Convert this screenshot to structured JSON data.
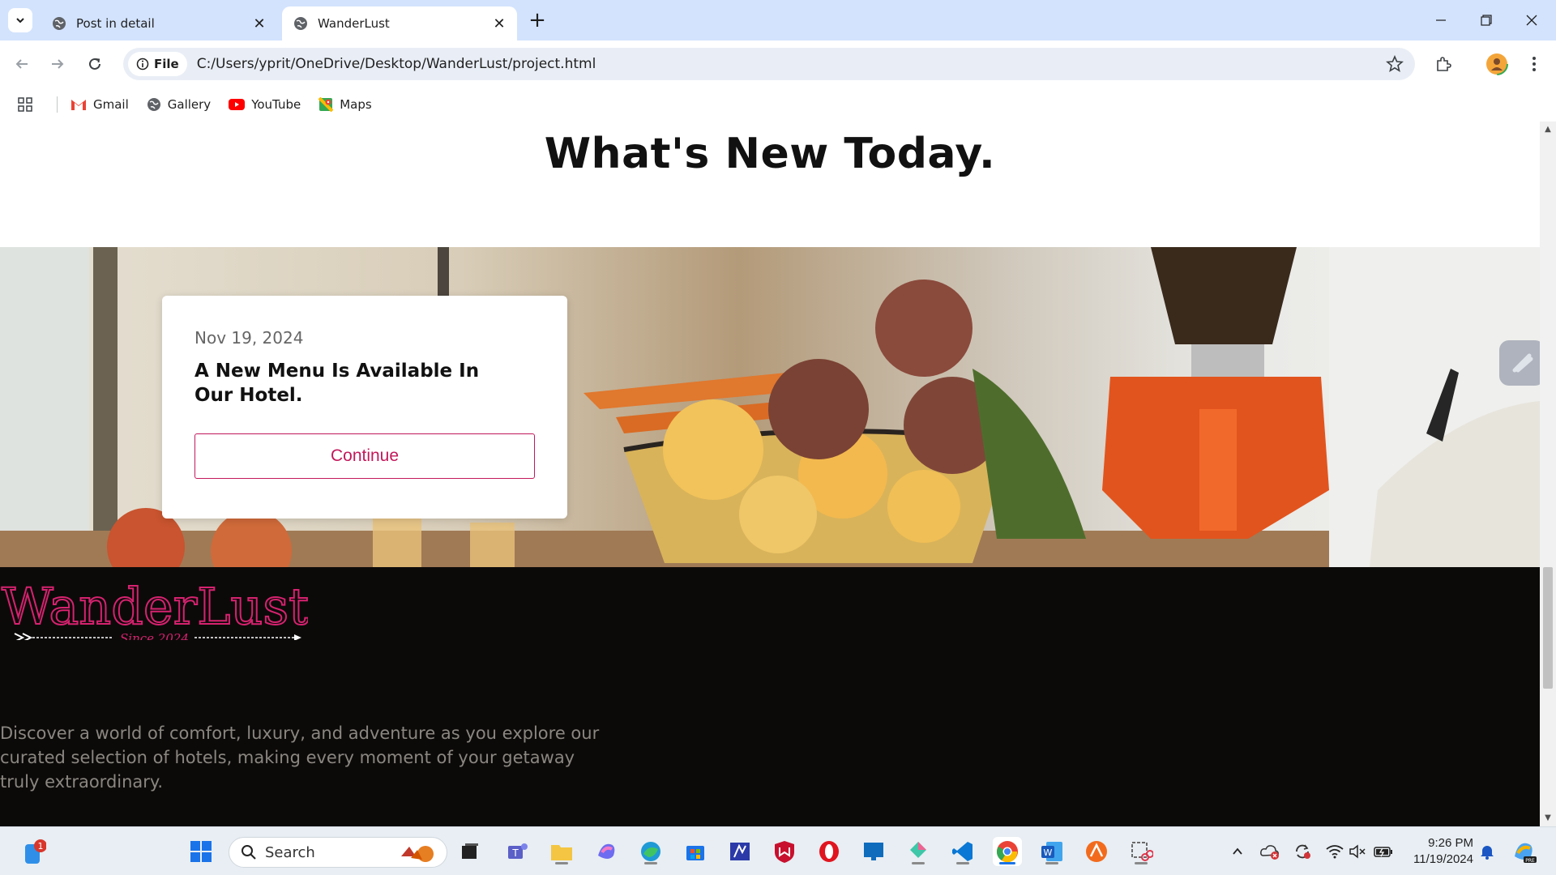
{
  "browser": {
    "tabs": [
      {
        "title": "Post in detail",
        "active": false
      },
      {
        "title": "WanderLust",
        "active": true
      }
    ],
    "file_chip": "File",
    "url": "C:/Users/yprit/OneDrive/Desktop/WanderLust/project.html",
    "bookmarks": [
      {
        "label": "Gmail",
        "icon": "gmail-icon"
      },
      {
        "label": "Gallery",
        "icon": "globe-icon"
      },
      {
        "label": "YouTube",
        "icon": "youtube-icon"
      },
      {
        "label": "Maps",
        "icon": "maps-icon"
      }
    ]
  },
  "page": {
    "heading": "What's New Today.",
    "card": {
      "date": "Nov 19, 2024",
      "title": "A New Menu Is Available In Our Hotel.",
      "button": "Continue"
    },
    "footer": {
      "logo_text": "WanderLust",
      "logo_tagline": "Since 2024",
      "description": "Discover a world of comfort, luxury, and adventure as you explore our curated selection of hotels, making every moment of your getaway truly extraordinary."
    }
  },
  "taskbar": {
    "search_placeholder": "Search",
    "notification_count": "1",
    "time": "9:26 PM",
    "date": "11/19/2024"
  },
  "colors": {
    "accent_pink": "#c2185b",
    "footer_bg": "#0c0a09",
    "tabbar_bg": "#d3e3fd"
  }
}
